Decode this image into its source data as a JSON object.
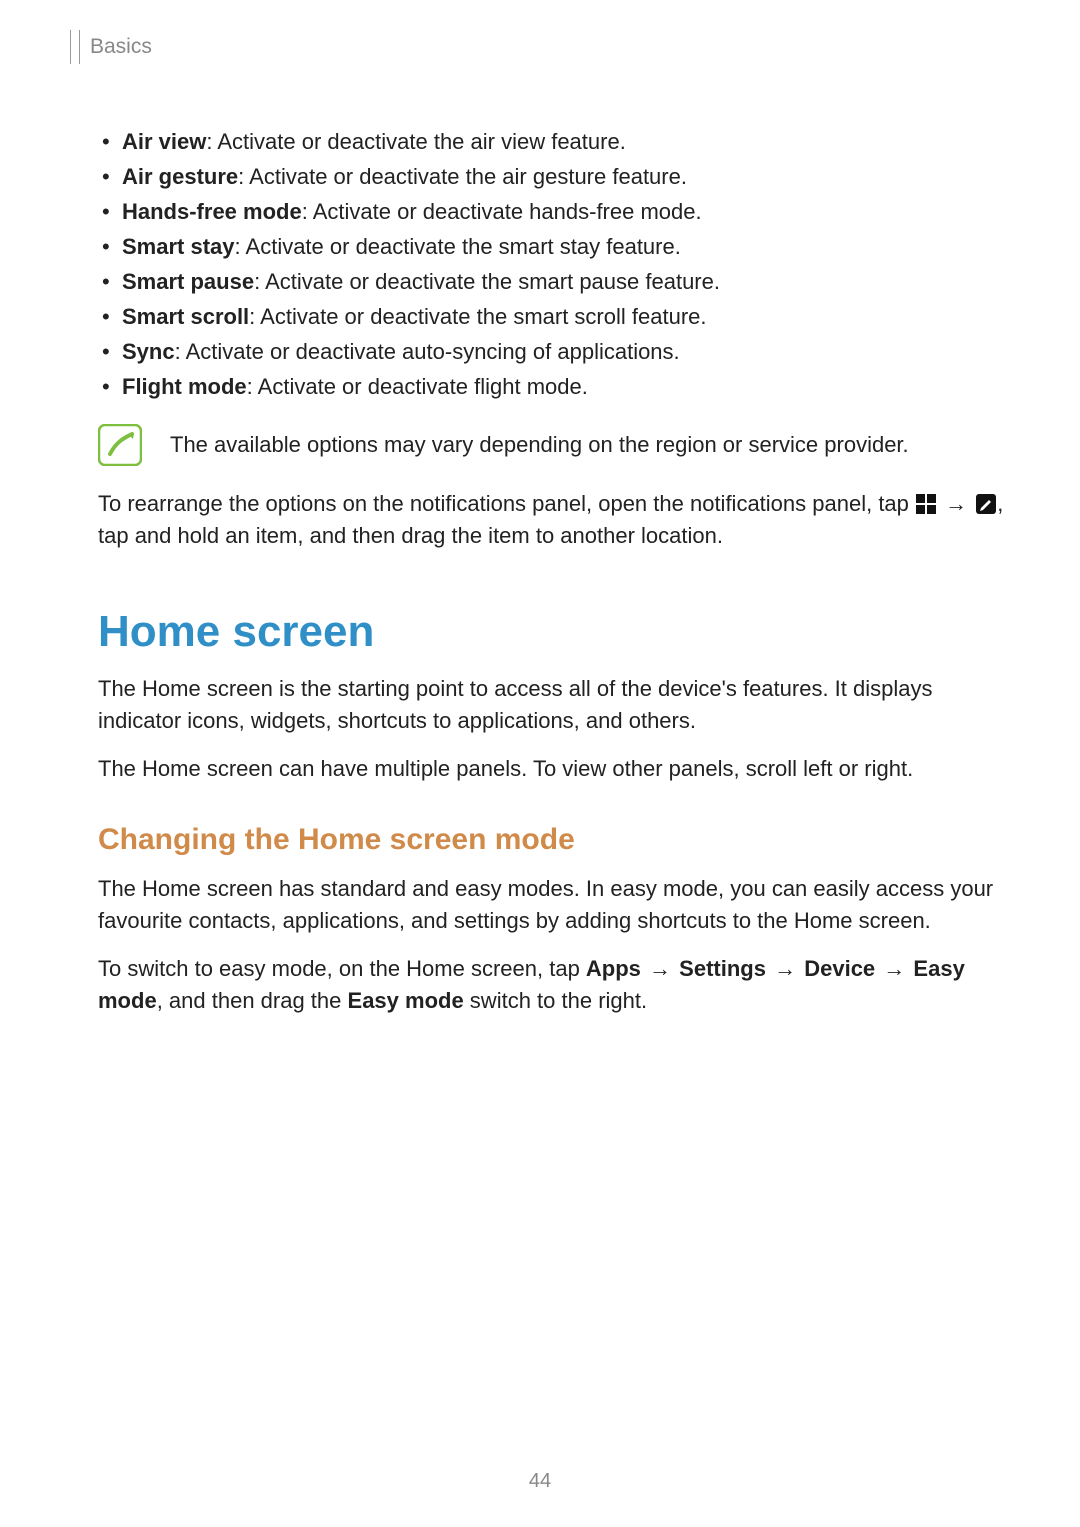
{
  "breadcrumb": "Basics",
  "features": [
    {
      "name": "Air view",
      "desc": ": Activate or deactivate the air view feature."
    },
    {
      "name": "Air gesture",
      "desc": ": Activate or deactivate the air gesture feature."
    },
    {
      "name": "Hands-free mode",
      "desc": ": Activate or deactivate hands-free mode."
    },
    {
      "name": "Smart stay",
      "desc": ": Activate or deactivate the smart stay feature."
    },
    {
      "name": "Smart pause",
      "desc": ": Activate or deactivate the smart pause feature."
    },
    {
      "name": "Smart scroll",
      "desc": ": Activate or deactivate the smart scroll feature."
    },
    {
      "name": "Sync",
      "desc": ": Activate or deactivate auto-syncing of applications."
    },
    {
      "name": "Flight mode",
      "desc": ": Activate or deactivate flight mode."
    }
  ],
  "note": "The available options may vary depending on the region or service provider.",
  "rearrange": {
    "pre": "To rearrange the options on the notifications panel, open the notifications panel, tap ",
    "arrow": "→",
    "post": ", tap and hold an item, and then drag the item to another location."
  },
  "home_screen": {
    "title": "Home screen",
    "p1": "The Home screen is the starting point to access all of the device's features. It displays indicator icons, widgets, shortcuts to applications, and others.",
    "p2": "The Home screen can have multiple panels. To view other panels, scroll left or right."
  },
  "changing_mode": {
    "title": "Changing the Home screen mode",
    "p1": "The Home screen has standard and easy modes. In easy mode, you can easily access your favourite contacts, applications, and settings by adding shortcuts to the Home screen.",
    "p2_pre": "To switch to easy mode, on the Home screen, tap ",
    "apps": "Apps",
    "settings": "Settings",
    "device": "Device",
    "easy_mode": "Easy mode",
    "arrow": "→",
    "p2_post": ", and then drag the ",
    "easy_mode2": "Easy mode",
    "p2_end": " switch to the right."
  },
  "page_number": "44"
}
